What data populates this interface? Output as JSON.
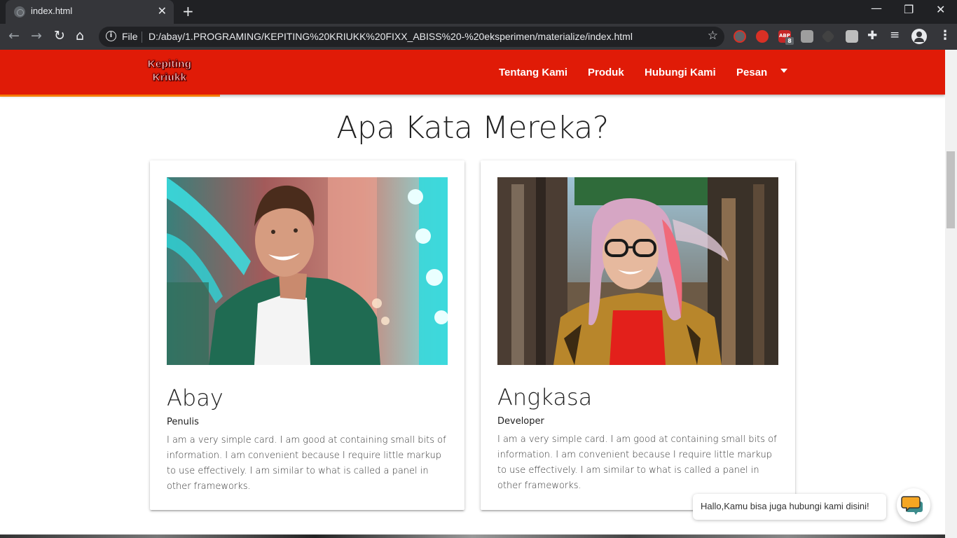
{
  "browser": {
    "tab_title": "index.html",
    "tab_close": "✕",
    "new_tab": "+",
    "address_scheme": "File",
    "address_url": "D:/abay/1.PROGRAMING/KEPITING%20KRIUKK%20FIXX_ABISS%20-%20eksperimen/materialize/index.html",
    "ext_badge": "8",
    "ext_abp_label": "ABP"
  },
  "navbar": {
    "logo_line1": "Kepiting",
    "logo_line2": "Kriukk",
    "links": [
      "Tentang Kami",
      "Produk",
      "Hubungi Kami",
      "Pesan"
    ],
    "accent": "#e01b07"
  },
  "section": {
    "title": "Apa Kata Mereka?"
  },
  "cards": [
    {
      "name": "Abay",
      "role": "Penulis",
      "text": "I am a very simple card. I am good at containing small bits of information. I am convenient because I require little markup to use effectively. I am similar to what is called a panel in other frameworks.",
      "image": "photo of smiling young man in green shirt with colorful lights"
    },
    {
      "name": "Angkasa",
      "role": "Developer",
      "text": "I am a very simple card. I am good at containing small bits of information. I am convenient because I require little markup to use effectively. I am similar to what is called a panel in other frameworks.",
      "image": "photo of smiling young woman with glasses and pastel hair"
    }
  ],
  "chat": {
    "bubble_text": "Hallo,Kamu bisa juga hubungi kami disini!"
  }
}
